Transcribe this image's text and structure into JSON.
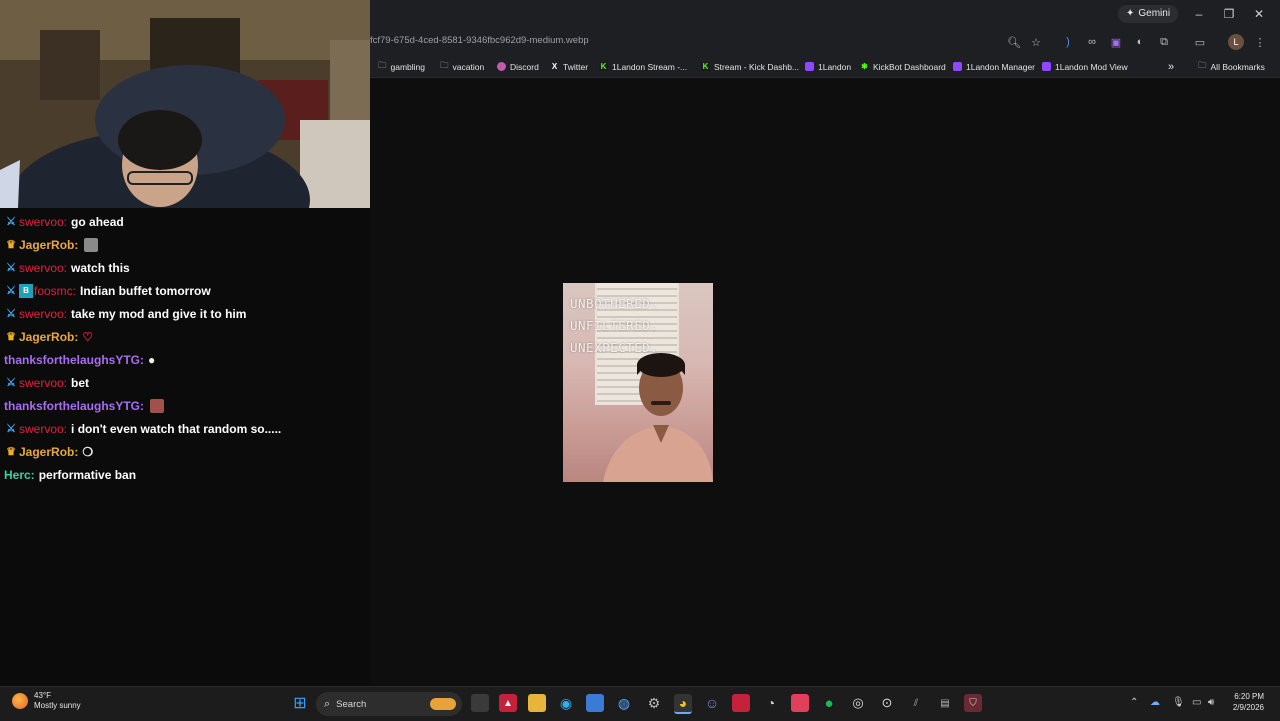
{
  "browser": {
    "gemini_label": "Gemini",
    "url": "fcf79-675d-4ced-8581-9346fbc962d9-medium.webp",
    "window_controls": {
      "minimize": "–",
      "restore": "❐",
      "close": "✕"
    },
    "profile_initial": "L",
    "bookmarks": [
      {
        "label": "gambling",
        "icon": "folder-icon"
      },
      {
        "label": "vacation",
        "icon": "folder-icon"
      },
      {
        "label": "Discord",
        "icon": "discord-icon"
      },
      {
        "label": "Twitter",
        "icon": "x-icon"
      },
      {
        "label": "1Landon Stream -...",
        "icon": "kick-icon"
      },
      {
        "label": "Stream - Kick Dashb...",
        "icon": "kick-icon"
      },
      {
        "label": "1Landon",
        "icon": "twitch-icon"
      },
      {
        "label": "KickBot Dashboard",
        "icon": "kickbot-icon"
      },
      {
        "label": "1Landon Manager",
        "icon": "twitch-icon"
      },
      {
        "label": "1Landon Mod View",
        "icon": "twitch-icon"
      }
    ],
    "more_bookmarks": "»",
    "all_bookmarks": "All Bookmarks"
  },
  "image": {
    "caption": "UNBOTHERED.\nUNFILTERED.\nUNEXPECTED."
  },
  "chat": {
    "messages": [
      {
        "badge": "sword",
        "user": "swervoo:",
        "color": "red",
        "text": "go ahead"
      },
      {
        "badge": "crown",
        "user": "JagerRob:",
        "color": "gold",
        "text": "",
        "emote": "#8a8a8a"
      },
      {
        "badge": "sword",
        "user": "swervoo:",
        "color": "red",
        "text": "watch this"
      },
      {
        "badge": "sword",
        "user": "foosmc:",
        "color": "red",
        "text": "Indian buffet tomorrow"
      },
      {
        "badge": "sword",
        "user": "swervoo:",
        "color": "red",
        "text": "take my mod and give it to him"
      },
      {
        "badge": "crown",
        "user": "JagerRob:",
        "color": "gold",
        "text": "",
        "emote_glyph": "♡"
      },
      {
        "badge": "",
        "user": "thanksforthelaughsYTG:",
        "color": "purple",
        "text": "",
        "emote_glyph": "●"
      },
      {
        "badge": "sword",
        "user": "swervoo:",
        "color": "red",
        "text": "bet"
      },
      {
        "badge": "",
        "user": "thanksforthelaughsYTG:",
        "color": "purple",
        "text": "",
        "emote": "#a0524a"
      },
      {
        "badge": "sword",
        "user": "swervoo:",
        "color": "red",
        "text": "i don't even watch that random so....."
      },
      {
        "badge": "crown",
        "user": "JagerRob:",
        "color": "gold",
        "text": "",
        "emote_glyph": "❍"
      },
      {
        "badge": "",
        "user": "Herc:",
        "color": "teal",
        "text": "performative ban"
      }
    ]
  },
  "taskbar": {
    "weather_temp": "43°F",
    "weather_desc": "Mostly sunny",
    "search_label": "Search",
    "time": "6:20 PM",
    "date": "2/9/2026"
  },
  "colors": {
    "red": "#e0203a",
    "gold": "#e7a93d",
    "purple": "#a86df2",
    "teal": "#38d0a6",
    "chrome_bg": "#1e1f22",
    "viewer_bg": "#0e0e0e"
  }
}
